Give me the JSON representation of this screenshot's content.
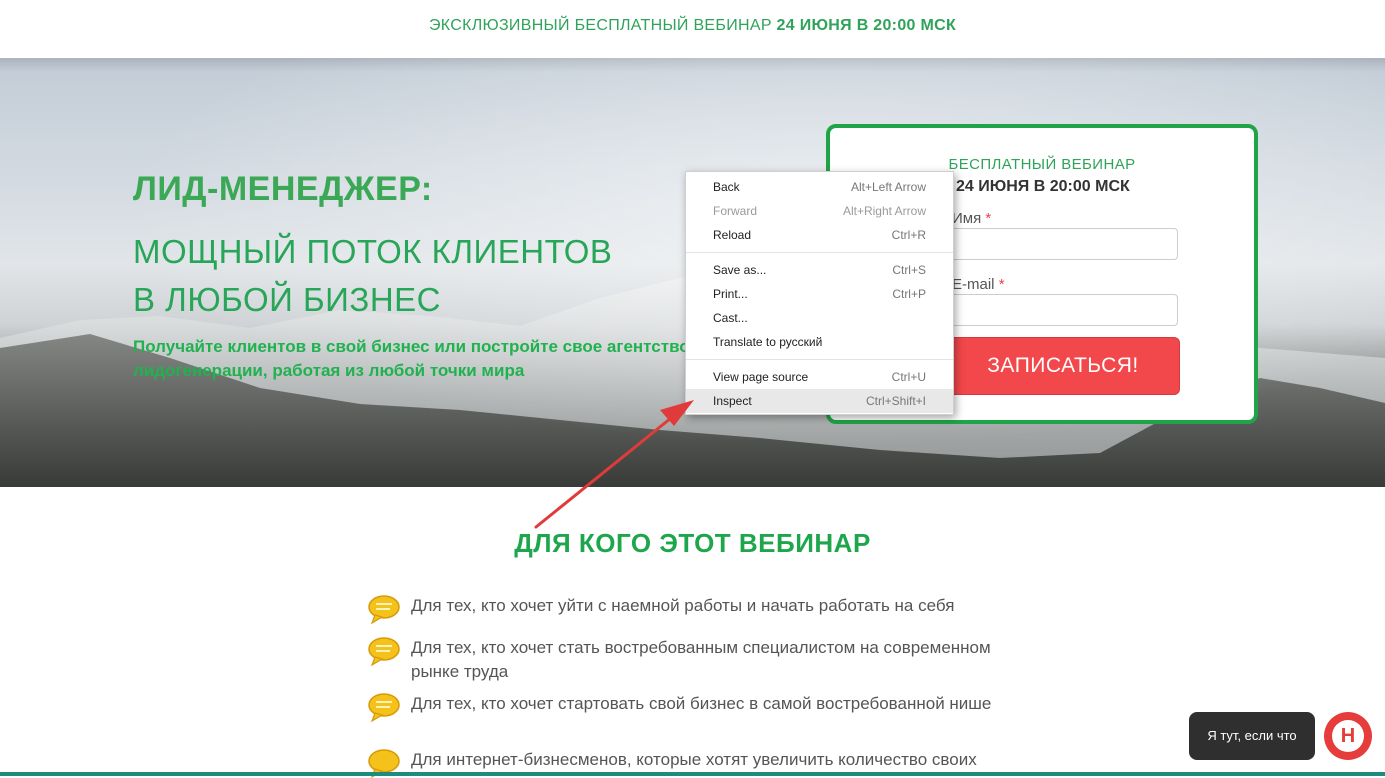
{
  "colors": {
    "accent": "#1fa447",
    "cta": "#f2474b",
    "chat_bg": "#2f2f2f",
    "chat_btn": "#e73c3c"
  },
  "topbar": {
    "text": "ЭКСКЛЮЗИВНЫЙ БЕСПЛАТНЫЙ ВЕБИНАР",
    "date": "24 ИЮНЯ В 20:00 МСК"
  },
  "hero": {
    "title1": "ЛИД-МЕНЕДЖЕР:",
    "title2_line1": "МОЩНЫЙ ПОТОК КЛИЕНТОВ",
    "title2_line2": "В ЛЮБОЙ БИЗНЕС",
    "subtitle_line1": "Получайте клиентов в свой бизнес или постройте свое агентство",
    "subtitle_line2": "лидогенерации, работая из любой точки мира"
  },
  "form": {
    "label": "БЕСПЛАТНЫЙ ВЕБИНАР",
    "date": "24 ИЮНЯ В 20:00 МСК",
    "name_label": "Имя",
    "email_label": "E-mail",
    "required_mark": "*",
    "name_value": "",
    "email_value": "",
    "submit": "ЗАПИСАТЬСЯ!"
  },
  "context_menu": {
    "items": [
      {
        "label": "Back",
        "shortcut": "Alt+Left Arrow",
        "disabled": false
      },
      {
        "label": "Forward",
        "shortcut": "Alt+Right Arrow",
        "disabled": true
      },
      {
        "label": "Reload",
        "shortcut": "Ctrl+R",
        "disabled": false
      },
      {
        "label": "Save as...",
        "shortcut": "Ctrl+S",
        "disabled": false
      },
      {
        "label": "Print...",
        "shortcut": "Ctrl+P",
        "disabled": false
      },
      {
        "label": "Cast...",
        "shortcut": "",
        "disabled": false
      },
      {
        "label": "Translate to русский",
        "shortcut": "",
        "disabled": false
      },
      {
        "label": "View page source",
        "shortcut": "Ctrl+U",
        "disabled": false
      },
      {
        "label": "Inspect",
        "shortcut": "Ctrl+Shift+I",
        "disabled": false
      }
    ]
  },
  "section": {
    "title": "ДЛЯ КОГО ЭТОТ ВЕБИНАР",
    "items": [
      "Для тех, кто хочет уйти с наемной работы и начать работать на себя",
      "Для тех, кто хочет стать востребованным специалистом на современном рынке труда",
      "Для тех, кто хочет стартовать свой бизнес в самой востребованной нише",
      "Для интернет-бизнесменов, которые хотят увеличить количество своих"
    ]
  },
  "chat": {
    "text": "Я тут, если что",
    "icon": "chat-logo-icon"
  }
}
